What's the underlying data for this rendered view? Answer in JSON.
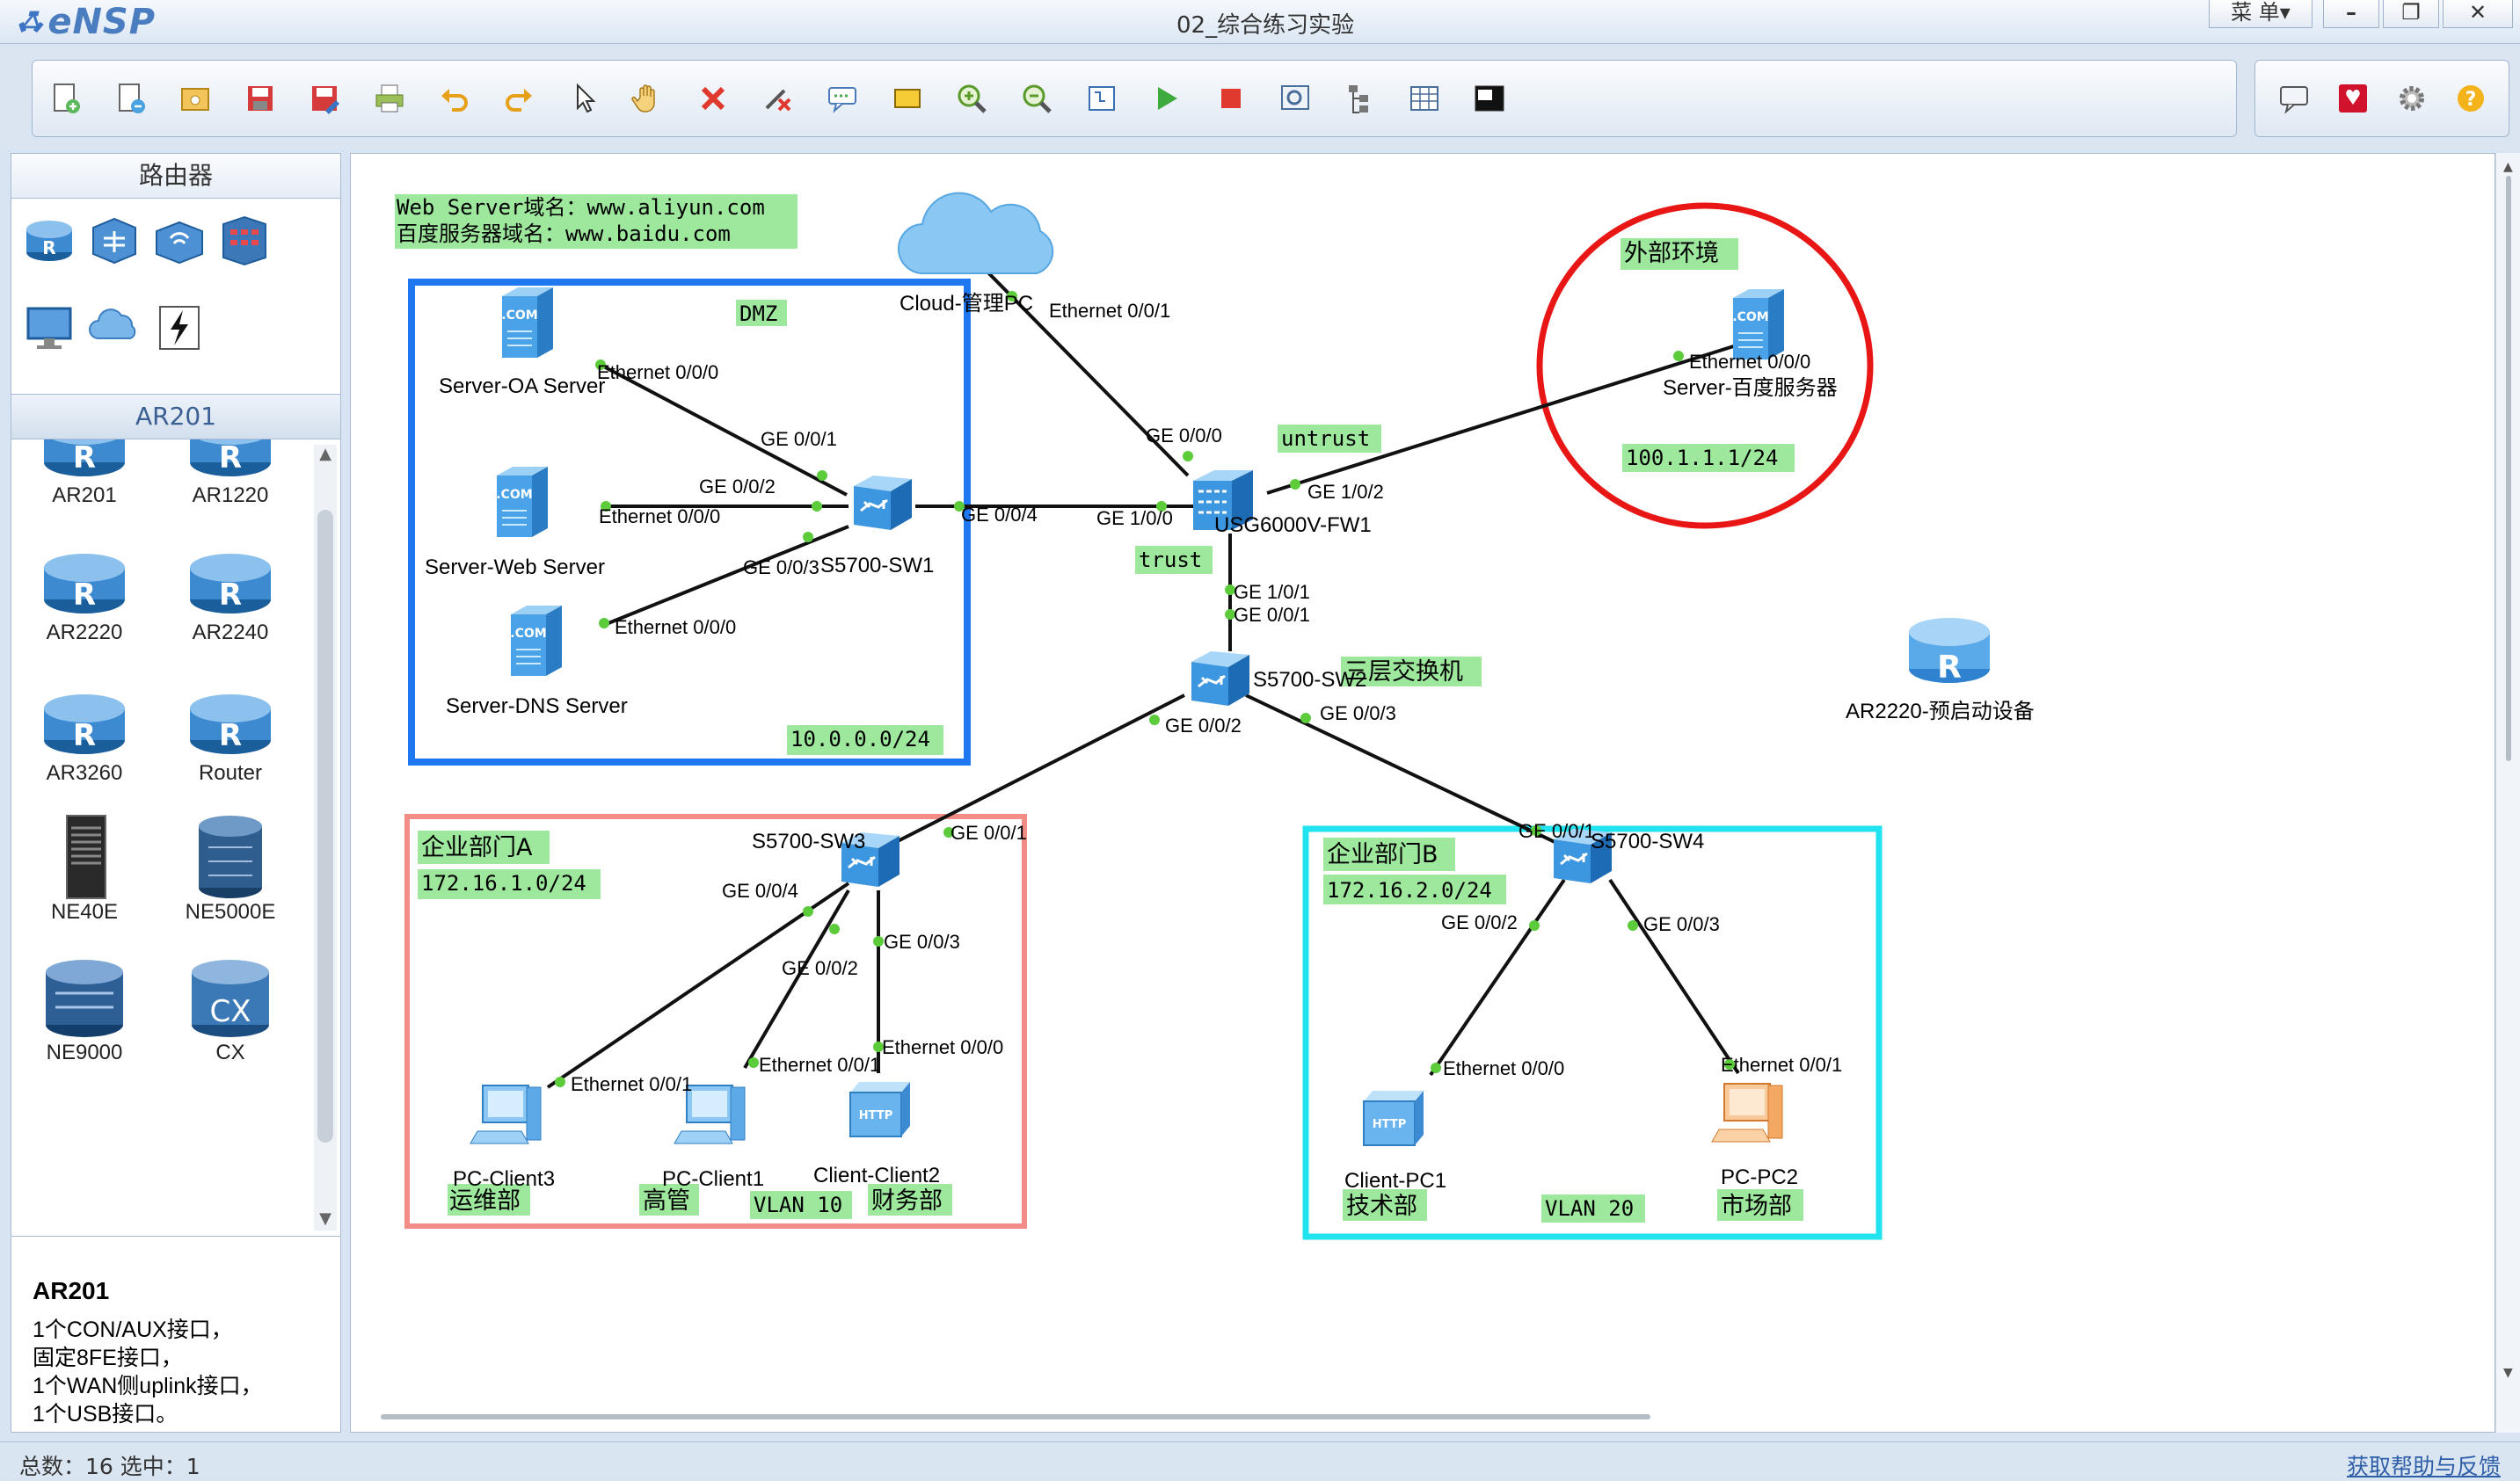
{
  "app": {
    "name": "eNSP",
    "window_title": "02_综合练习实验",
    "menu_label": "菜 单▾"
  },
  "window_controls": {
    "minimize": "–",
    "restore": "❐",
    "close": "✕"
  },
  "toolbar": {
    "left": [
      "new-topology",
      "new-example",
      "open",
      "save",
      "save-as",
      "print",
      "undo",
      "redo",
      "select",
      "drag",
      "delete",
      "delete-link",
      "add-textbox",
      "add-shape",
      "zoom-in",
      "zoom-out",
      "fit-view",
      "start-devices",
      "stop-devices",
      "capture-data",
      "show-interfaces",
      "topology-grid",
      "cli-console"
    ],
    "right": [
      "chat",
      "huawei-forum",
      "settings",
      "help"
    ]
  },
  "sidebar": {
    "category_title": "路由器",
    "category_icons": [
      "router-icon",
      "switch-icon",
      "wireless-icon",
      "firewall-icon",
      "pc-icon",
      "cloud-icon",
      "link-icon"
    ],
    "subcategory_title": "AR201",
    "devices": [
      "AR201",
      "AR1220",
      "AR2220",
      "AR2240",
      "AR3260",
      "Router",
      "NE40E",
      "NE5000E",
      "NE9000",
      "CX"
    ],
    "description_title": "AR201",
    "description_lines": [
      "1个CON/AUX接口，",
      "固定8FE接口，",
      "1个WAN侧uplink接口，",
      "1个USB接口。"
    ]
  },
  "topology": {
    "notes": {
      "web_domain": "Web Server域名：www.aliyun.com",
      "baidu_domain": "百度服务器域名：www.baidu.com"
    },
    "zones": {
      "dmz": "DMZ",
      "dmz_net": "10.0.0.0/24",
      "external": "外部环境",
      "external_net": "100.1.1.1/24",
      "untrust": "untrust",
      "trust": "trust",
      "core": "三层交换机",
      "dept_a": "企业部门A",
      "dept_a_net": "172.16.1.0/24",
      "dept_b": "企业部门B",
      "dept_b_net": "172.16.2.0/24",
      "vlan10": "VLAN 10",
      "vlan20": "VLAN 20",
      "ops": "运维部",
      "mgmt": "高管",
      "finance": "财务部",
      "tech": "技术部",
      "market": "市场部"
    },
    "devices": {
      "oa": "Server-OA Server",
      "web": "Server-Web Server",
      "dns": "Server-DNS Server",
      "sw1": "S5700-SW1",
      "cloud": "Cloud-管理PC",
      "fw": "USG6000V-FW1",
      "baidu": "Server-百度服务器",
      "sw2": "S5700-SW2",
      "ar": "AR2220-预启动设备",
      "sw3": "S5700-SW3",
      "sw4": "S5700-SW4",
      "pc3": "PC-Client3",
      "pc1": "PC-Client1",
      "client2": "Client-Client2",
      "cpc1": "Client-PC1",
      "pc2": "PC-PC2"
    },
    "ports": {
      "oa_e": "Ethernet 0/0/0",
      "web_e": "Ethernet 0/0/0",
      "dns_e": "Ethernet 0/0/0",
      "sw1_g1": "GE 0/0/1",
      "sw1_g2": "GE 0/0/2",
      "sw1_g3": "GE 0/0/3",
      "sw1_g4": "GE 0/0/4",
      "cloud_e": "Ethernet 0/0/1",
      "fw_g000": "GE 0/0/0",
      "fw_g100": "GE 1/0/0",
      "fw_g102": "GE 1/0/2",
      "fw_g101": "GE 1/0/1",
      "baidu_e": "Ethernet 0/0/0",
      "sw2_g1": "GE 0/0/1",
      "sw2_g2": "GE 0/0/2",
      "sw2_g3": "GE 0/0/3",
      "sw3_g1": "GE 0/0/1",
      "sw3_g4": "GE 0/0/4",
      "sw3_g2": "GE 0/0/2",
      "sw3_g3": "GE 0/0/3",
      "pc3_e": "Ethernet 0/0/1",
      "pc1_e": "Ethernet 0/0/1",
      "client2_e": "Ethernet 0/0/0",
      "sw4_g1": "GE 0/0/1",
      "sw4_g2": "GE 0/0/2",
      "sw4_g3": "GE 0/0/3",
      "cpc1_e": "Ethernet 0/0/0",
      "pc2_e": "Ethernet 0/0/1"
    }
  },
  "status": {
    "left": "总数：16 选中：1",
    "right": "获取帮助与反馈"
  }
}
